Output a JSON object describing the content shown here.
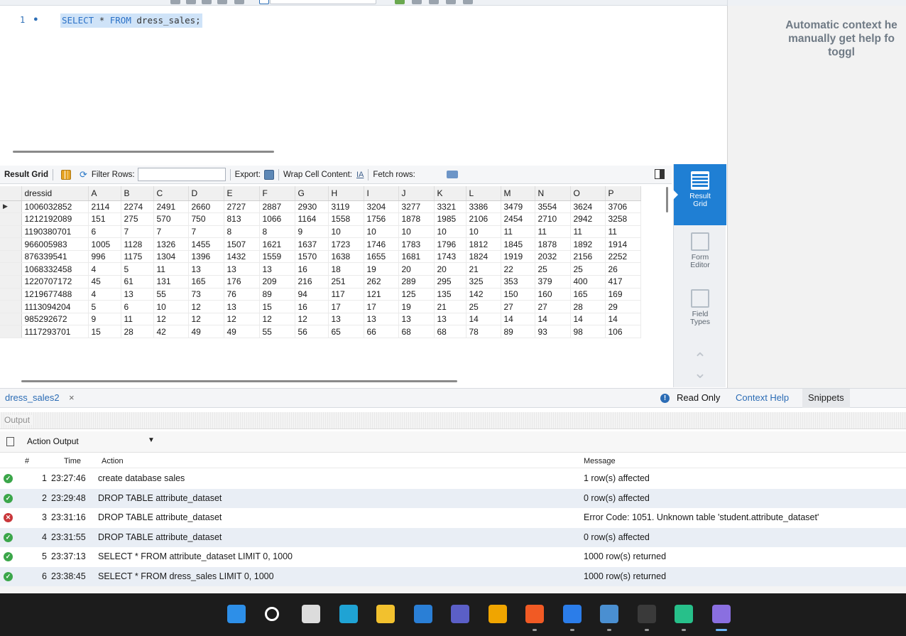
{
  "editor": {
    "line_number": "1",
    "line_marker": "●",
    "sql_keyword_1": "SELECT",
    "sql_star": "*",
    "sql_keyword_2": "FROM",
    "sql_table": "dress_sales;"
  },
  "context_help": {
    "line1": "Automatic context he",
    "line2": "manually get help fo",
    "line3": "toggl"
  },
  "result_toolbar": {
    "result_grid": "Result Grid",
    "filter_rows": "Filter Rows:",
    "export": "Export:",
    "wrap_cell": "Wrap Cell Content:",
    "fetch_rows": "Fetch rows:"
  },
  "grid": {
    "columns": [
      "dressid",
      "A",
      "B",
      "C",
      "D",
      "E",
      "F",
      "G",
      "H",
      "I",
      "J",
      "K",
      "L",
      "M",
      "N",
      "O",
      "P"
    ],
    "rows": [
      [
        "1006032852",
        "2114",
        "2274",
        "2491",
        "2660",
        "2727",
        "2887",
        "2930",
        "3119",
        "3204",
        "3277",
        "3321",
        "3386",
        "3479",
        "3554",
        "3624",
        "3706"
      ],
      [
        "1212192089",
        "151",
        "275",
        "570",
        "750",
        "813",
        "1066",
        "1164",
        "1558",
        "1756",
        "1878",
        "1985",
        "2106",
        "2454",
        "2710",
        "2942",
        "3258"
      ],
      [
        "1190380701",
        "6",
        "7",
        "7",
        "7",
        "8",
        "8",
        "9",
        "10",
        "10",
        "10",
        "10",
        "10",
        "11",
        "11",
        "11",
        "11"
      ],
      [
        "966005983",
        "1005",
        "1128",
        "1326",
        "1455",
        "1507",
        "1621",
        "1637",
        "1723",
        "1746",
        "1783",
        "1796",
        "1812",
        "1845",
        "1878",
        "1892",
        "1914"
      ],
      [
        "876339541",
        "996",
        "1175",
        "1304",
        "1396",
        "1432",
        "1559",
        "1570",
        "1638",
        "1655",
        "1681",
        "1743",
        "1824",
        "1919",
        "2032",
        "2156",
        "2252"
      ],
      [
        "1068332458",
        "4",
        "5",
        "11",
        "13",
        "13",
        "13",
        "16",
        "18",
        "19",
        "20",
        "20",
        "21",
        "22",
        "25",
        "25",
        "26"
      ],
      [
        "1220707172",
        "45",
        "61",
        "131",
        "165",
        "176",
        "209",
        "216",
        "251",
        "262",
        "289",
        "295",
        "325",
        "353",
        "379",
        "400",
        "417"
      ],
      [
        "1219677488",
        "4",
        "13",
        "55",
        "73",
        "76",
        "89",
        "94",
        "117",
        "121",
        "125",
        "135",
        "142",
        "150",
        "160",
        "165",
        "169"
      ],
      [
        "1113094204",
        "5",
        "6",
        "10",
        "12",
        "13",
        "15",
        "16",
        "17",
        "17",
        "19",
        "21",
        "25",
        "27",
        "27",
        "28",
        "29"
      ],
      [
        "985292672",
        "9",
        "11",
        "12",
        "12",
        "12",
        "12",
        "12",
        "13",
        "13",
        "13",
        "13",
        "14",
        "14",
        "14",
        "14",
        "14"
      ],
      [
        "1117293701",
        "15",
        "28",
        "42",
        "49",
        "49",
        "55",
        "56",
        "65",
        "66",
        "68",
        "68",
        "78",
        "89",
        "93",
        "98",
        "106"
      ]
    ],
    "current_row_marker": "▶"
  },
  "side_tools": {
    "result_grid": [
      "Result",
      "Grid"
    ],
    "form_editor": [
      "Form",
      "Editor"
    ],
    "field_types": [
      "Field",
      "Types"
    ]
  },
  "tabs": {
    "query_tab": "dress_sales2",
    "close": "×",
    "read_only": "Read Only",
    "context_help": "Context Help",
    "snippets": "Snippets"
  },
  "output": {
    "label": "Output",
    "selector": "Action Output",
    "headers": {
      "num": "#",
      "time": "Time",
      "action": "Action",
      "message": "Message"
    },
    "rows": [
      {
        "status": "ok",
        "num": "1",
        "time": "23:27:46",
        "action": "create database sales",
        "message": "1 row(s) affected"
      },
      {
        "status": "ok",
        "num": "2",
        "time": "23:29:48",
        "action": "DROP TABLE attribute_dataset",
        "message": "0 row(s) affected"
      },
      {
        "status": "err",
        "num": "3",
        "time": "23:31:16",
        "action": "DROP TABLE attribute_dataset",
        "message": "Error Code: 1051. Unknown table 'student.attribute_dataset'"
      },
      {
        "status": "ok",
        "num": "4",
        "time": "23:31:55",
        "action": "DROP TABLE attribute_dataset",
        "message": "0 row(s) affected"
      },
      {
        "status": "ok",
        "num": "5",
        "time": "23:37:13",
        "action": "SELECT * FROM attribute_dataset LIMIT 0, 1000",
        "message": "1000 row(s) returned"
      },
      {
        "status": "ok",
        "num": "6",
        "time": "23:38:45",
        "action": "SELECT * FROM dress_sales LIMIT 0, 1000",
        "message": "1000 row(s) returned"
      }
    ]
  },
  "colors": {
    "accent": "#1f7fd4",
    "ok": "#3ba64a",
    "error": "#c9363a",
    "taskbar": "#1c1c1c"
  },
  "taskbar": {
    "apps": [
      "windows-start-icon",
      "search-icon",
      "task-view-icon",
      "edge-icon",
      "file-explorer-icon",
      "mail-icon",
      "visual-studio-icon",
      "chrome-icon",
      "brave-icon",
      "notepad-icon",
      "mysql-workbench-icon",
      "terminal-icon",
      "pycharm-icon",
      "snipping-tool-icon"
    ]
  }
}
